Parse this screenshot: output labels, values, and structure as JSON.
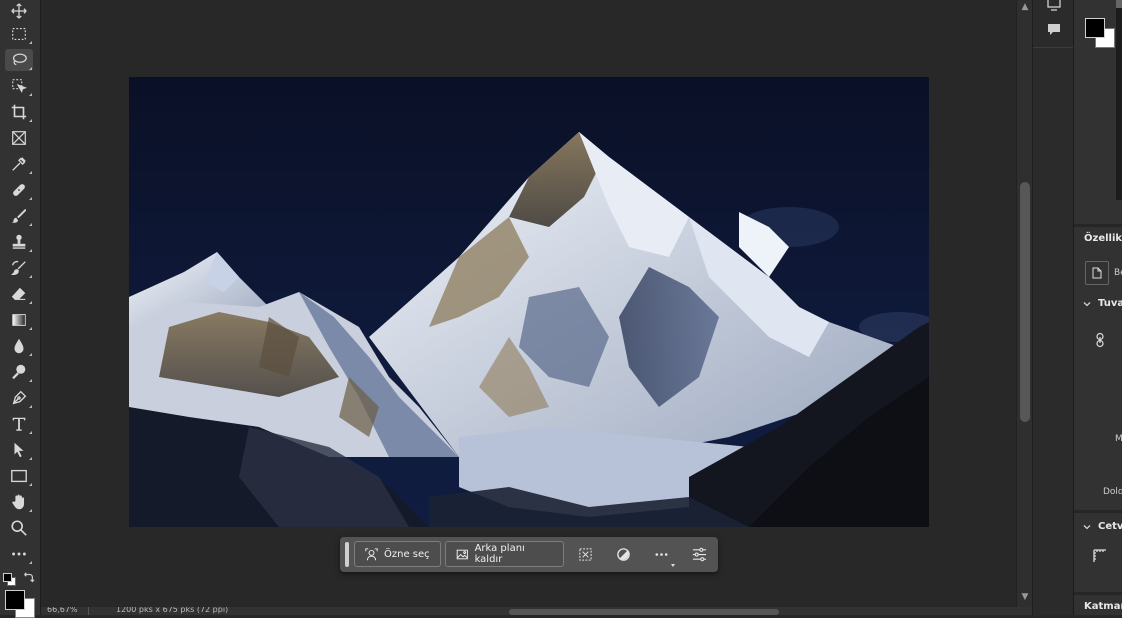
{
  "tools": [
    {
      "name": "move-tool-icon"
    },
    {
      "name": "rectangular-marquee-icon"
    },
    {
      "name": "lasso-tool-icon",
      "active": true
    },
    {
      "name": "object-selection-icon"
    },
    {
      "name": "crop-tool-icon"
    },
    {
      "name": "frame-tool-icon"
    },
    {
      "name": "eyedropper-icon"
    },
    {
      "name": "healing-brush-icon"
    },
    {
      "name": "brush-tool-icon"
    },
    {
      "name": "clone-stamp-icon"
    },
    {
      "name": "history-brush-icon"
    },
    {
      "name": "eraser-icon"
    },
    {
      "name": "gradient-tool-icon"
    },
    {
      "name": "blur-tool-icon"
    },
    {
      "name": "dodge-tool-icon"
    },
    {
      "name": "pen-tool-icon"
    },
    {
      "name": "type-tool-icon"
    },
    {
      "name": "path-selection-icon"
    },
    {
      "name": "rectangle-tool-icon"
    },
    {
      "name": "hand-tool-icon"
    },
    {
      "name": "zoom-tool-icon"
    },
    {
      "name": "more-tools-icon"
    }
  ],
  "toolbar": {
    "foreground_color": "#000000",
    "background_color": "#ffffff"
  },
  "context_bar": {
    "select_subject_label": "Özne seç",
    "remove_background_label": "Arka planı kaldır"
  },
  "status_bar": {
    "zoom": "66,67%",
    "doc_info": "1200 pks x 675 pks (72 ppi)"
  },
  "right_panel": {
    "properties_title": "Özellikle",
    "layer_type": "Be",
    "canvas_section": "Tuva",
    "m_label": "M",
    "fill_label": "Dold",
    "rulers_section": "Cetv",
    "layers_title": "Katmanl"
  },
  "colors": {
    "app_bg": "#282828",
    "panel_bg": "#323232",
    "context_bar_bg": "#535353"
  }
}
